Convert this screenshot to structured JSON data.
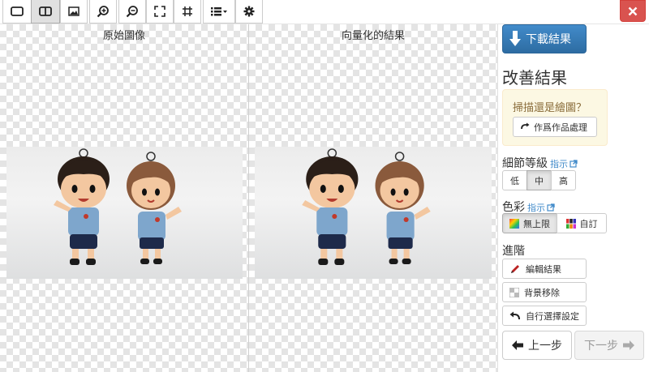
{
  "toolbar": {
    "buttons": [
      {
        "name": "single-view-icon",
        "active": false
      },
      {
        "name": "split-view-icon",
        "active": true
      },
      {
        "name": "image-icon",
        "active": false
      },
      {
        "name": "zoom-in-icon",
        "active": false
      },
      {
        "name": "zoom-out-icon",
        "active": false
      },
      {
        "name": "fit-screen-icon",
        "active": false
      },
      {
        "name": "actual-size-icon",
        "active": false
      },
      {
        "name": "list-menu-icon",
        "active": false
      },
      {
        "name": "gear-icon",
        "active": false
      }
    ],
    "close_icon": "close-icon"
  },
  "panes": {
    "original_title": "原始圖像",
    "vector_title": "向量化的結果"
  },
  "sidebar": {
    "download_label": "下載結果",
    "improve_title": "改善結果",
    "scan_question": "掃描還是繪圖？",
    "art_button_label": "作爲作品處理",
    "detail_label": "細節等級",
    "detail_hint": "指示",
    "detail_levels": [
      "低",
      "中",
      "高"
    ],
    "detail_selected": "中",
    "color_label": "色彩",
    "color_hint": "指示",
    "color_options": [
      "無上限",
      "自訂"
    ],
    "color_selected": "無上限",
    "advanced_label": "進階",
    "advanced_buttons": [
      "編輯結果",
      "背景移除",
      "自行選擇設定"
    ],
    "prev_label": "上一步",
    "next_label": "下一步"
  },
  "colors": {
    "accent_blue": "#2d6ca2",
    "close_red": "#d9534f",
    "warning_bg": "#fcf8e3",
    "link_blue": "#428bca"
  }
}
